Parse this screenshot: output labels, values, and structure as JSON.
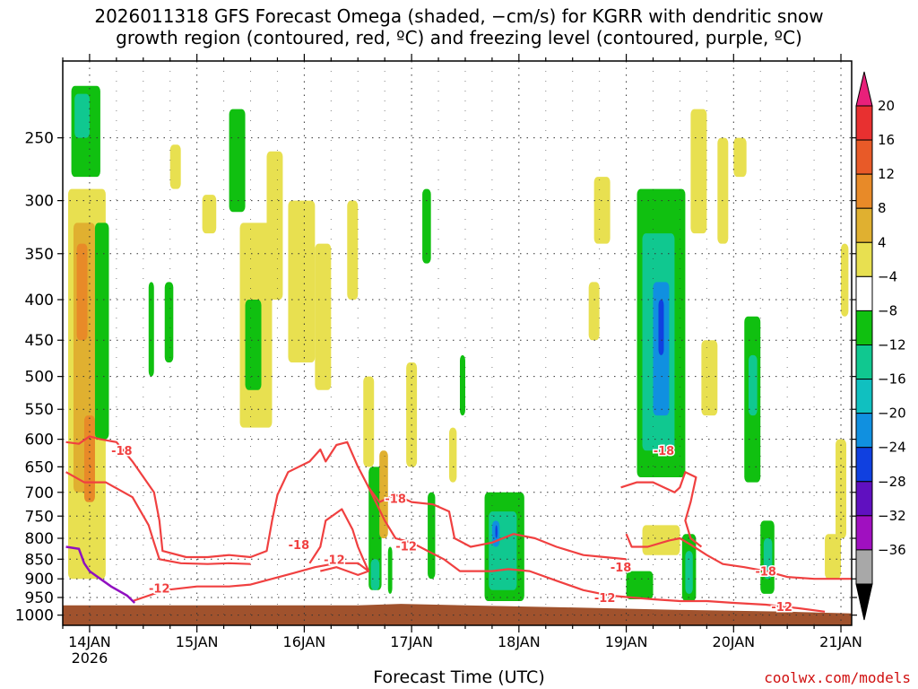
{
  "title_line1": "2026011318 GFS Forecast Omega (shaded, −cm/s) for KGRR with dendritic snow",
  "title_line2": "growth region (contoured, red, ºC) and freezing level (contoured, purple, ºC)",
  "xlabel": "Forecast Time (UTC)",
  "credit": "coolwx.com/models",
  "chart_data": {
    "type": "heatmap",
    "ylabel_ticks": [
      250,
      300,
      350,
      400,
      450,
      500,
      550,
      600,
      650,
      700,
      750,
      800,
      850,
      900,
      950,
      1000
    ],
    "y_units": "hPa",
    "y_scale": "log",
    "yrange": [
      200,
      1030
    ],
    "x_ticks": [
      {
        "day": 14,
        "label": "14JAN",
        "sub": "2026"
      },
      {
        "day": 15,
        "label": "15JAN",
        "sub": ""
      },
      {
        "day": 16,
        "label": "16JAN",
        "sub": ""
      },
      {
        "day": 17,
        "label": "17JAN",
        "sub": ""
      },
      {
        "day": 18,
        "label": "18JAN",
        "sub": ""
      },
      {
        "day": 19,
        "label": "19JAN",
        "sub": ""
      },
      {
        "day": 20,
        "label": "20JAN",
        "sub": ""
      },
      {
        "day": 21,
        "label": "21JAN",
        "sub": ""
      }
    ],
    "xrange_days": [
      13.75,
      21.1
    ],
    "grid": true,
    "colorbar": {
      "labels": [
        "20",
        "16",
        "12",
        "8",
        "4",
        "−4",
        "−8",
        "−12",
        "−16",
        "−20",
        "−24",
        "−28",
        "−32",
        "−36"
      ],
      "bins": [
        {
          "color": "#e8207a"
        },
        {
          "color": "#e83030"
        },
        {
          "color": "#e85a28"
        },
        {
          "color": "#e88a28"
        },
        {
          "color": "#e0b030"
        },
        {
          "color": "#e8e050"
        },
        {
          "color": "#ffffff"
        },
        {
          "color": "#10c010"
        },
        {
          "color": "#10c890"
        },
        {
          "color": "#10c0c0"
        },
        {
          "color": "#1090e0"
        },
        {
          "color": "#1040e0"
        },
        {
          "color": "#6010c0"
        },
        {
          "color": "#a010c0"
        },
        {
          "color": "#a8a8a8"
        },
        {
          "color": "#000000"
        }
      ]
    },
    "shaded_regions": [
      {
        "t0": 13.83,
        "t1": 14.1,
        "p0": 215,
        "p1": 280,
        "color": "#10c010"
      },
      {
        "t0": 13.86,
        "t1": 14.0,
        "p0": 220,
        "p1": 250,
        "color": "#10c890"
      },
      {
        "t0": 13.8,
        "t1": 14.15,
        "p0": 290,
        "p1": 900,
        "color": "#e8e050"
      },
      {
        "t0": 13.85,
        "t1": 14.05,
        "p0": 320,
        "p1": 700,
        "color": "#e0b030"
      },
      {
        "t0": 13.88,
        "t1": 13.98,
        "p0": 340,
        "p1": 450,
        "color": "#e88a28"
      },
      {
        "t0": 13.95,
        "t1": 14.05,
        "p0": 560,
        "p1": 720,
        "color": "#e88a28"
      },
      {
        "t0": 14.05,
        "t1": 14.18,
        "p0": 320,
        "p1": 600,
        "color": "#10c010"
      },
      {
        "t0": 14.55,
        "t1": 14.6,
        "p0": 380,
        "p1": 500,
        "color": "#10c010"
      },
      {
        "t0": 14.7,
        "t1": 14.78,
        "p0": 380,
        "p1": 480,
        "color": "#10c010"
      },
      {
        "t0": 14.75,
        "t1": 14.85,
        "p0": 255,
        "p1": 290,
        "color": "#e8e050"
      },
      {
        "t0": 15.05,
        "t1": 15.18,
        "p0": 295,
        "p1": 330,
        "color": "#e8e050"
      },
      {
        "t0": 15.3,
        "t1": 15.45,
        "p0": 230,
        "p1": 310,
        "color": "#10c010"
      },
      {
        "t0": 15.4,
        "t1": 15.7,
        "p0": 320,
        "p1": 580,
        "color": "#e8e050"
      },
      {
        "t0": 15.45,
        "t1": 15.6,
        "p0": 400,
        "p1": 520,
        "color": "#10c010"
      },
      {
        "t0": 15.65,
        "t1": 15.8,
        "p0": 260,
        "p1": 400,
        "color": "#e8e050"
      },
      {
        "t0": 15.85,
        "t1": 16.1,
        "p0": 300,
        "p1": 480,
        "color": "#e8e050"
      },
      {
        "t0": 16.1,
        "t1": 16.25,
        "p0": 340,
        "p1": 520,
        "color": "#e8e050"
      },
      {
        "t0": 16.4,
        "t1": 16.5,
        "p0": 300,
        "p1": 400,
        "color": "#e8e050"
      },
      {
        "t0": 16.55,
        "t1": 16.65,
        "p0": 500,
        "p1": 650,
        "color": "#e8e050"
      },
      {
        "t0": 16.6,
        "t1": 16.72,
        "p0": 650,
        "p1": 930,
        "color": "#10c010"
      },
      {
        "t0": 16.62,
        "t1": 16.7,
        "p0": 850,
        "p1": 930,
        "color": "#10c890"
      },
      {
        "t0": 16.7,
        "t1": 16.78,
        "p0": 620,
        "p1": 800,
        "color": "#e0b030"
      },
      {
        "t0": 16.78,
        "t1": 16.82,
        "p0": 820,
        "p1": 940,
        "color": "#10c010"
      },
      {
        "t0": 16.95,
        "t1": 17.05,
        "p0": 480,
        "p1": 650,
        "color": "#e8e050"
      },
      {
        "t0": 17.1,
        "t1": 17.18,
        "p0": 290,
        "p1": 360,
        "color": "#10c010"
      },
      {
        "t0": 17.15,
        "t1": 17.22,
        "p0": 700,
        "p1": 900,
        "color": "#10c010"
      },
      {
        "t0": 17.35,
        "t1": 17.42,
        "p0": 580,
        "p1": 680,
        "color": "#e8e050"
      },
      {
        "t0": 17.45,
        "t1": 17.5,
        "p0": 470,
        "p1": 560,
        "color": "#10c010"
      },
      {
        "t0": 17.68,
        "t1": 18.05,
        "p0": 700,
        "p1": 960,
        "color": "#10c010"
      },
      {
        "t0": 17.72,
        "t1": 17.98,
        "p0": 740,
        "p1": 930,
        "color": "#10c890"
      },
      {
        "t0": 17.75,
        "t1": 17.82,
        "p0": 760,
        "p1": 820,
        "color": "#1090e0"
      },
      {
        "t0": 17.78,
        "t1": 17.8,
        "p0": 770,
        "p1": 800,
        "color": "#1040e0"
      },
      {
        "t0": 18.7,
        "t1": 18.85,
        "p0": 280,
        "p1": 340,
        "color": "#e8e050"
      },
      {
        "t0": 18.65,
        "t1": 18.75,
        "p0": 380,
        "p1": 450,
        "color": "#e8e050"
      },
      {
        "t0": 19.1,
        "t1": 19.55,
        "p0": 290,
        "p1": 670,
        "color": "#10c010"
      },
      {
        "t0": 19.15,
        "t1": 19.45,
        "p0": 330,
        "p1": 620,
        "color": "#10c890"
      },
      {
        "t0": 19.25,
        "t1": 19.4,
        "p0": 380,
        "p1": 560,
        "color": "#1090e0"
      },
      {
        "t0": 19.3,
        "t1": 19.35,
        "p0": 400,
        "p1": 470,
        "color": "#1040e0"
      },
      {
        "t0": 19.6,
        "t1": 19.75,
        "p0": 230,
        "p1": 330,
        "color": "#e8e050"
      },
      {
        "t0": 19.0,
        "t1": 19.25,
        "p0": 880,
        "p1": 955,
        "color": "#10c010"
      },
      {
        "t0": 19.15,
        "t1": 19.5,
        "p0": 770,
        "p1": 840,
        "color": "#e8e050"
      },
      {
        "t0": 19.52,
        "t1": 19.65,
        "p0": 790,
        "p1": 960,
        "color": "#10c010"
      },
      {
        "t0": 19.55,
        "t1": 19.62,
        "p0": 830,
        "p1": 940,
        "color": "#10c890"
      },
      {
        "t0": 19.7,
        "t1": 19.85,
        "p0": 450,
        "p1": 560,
        "color": "#e8e050"
      },
      {
        "t0": 19.85,
        "t1": 19.95,
        "p0": 250,
        "p1": 340,
        "color": "#e8e050"
      },
      {
        "t0": 20.1,
        "t1": 20.25,
        "p0": 420,
        "p1": 680,
        "color": "#10c010"
      },
      {
        "t0": 20.14,
        "t1": 20.22,
        "p0": 470,
        "p1": 560,
        "color": "#10c890"
      },
      {
        "t0": 20.25,
        "t1": 20.38,
        "p0": 760,
        "p1": 940,
        "color": "#10c010"
      },
      {
        "t0": 20.28,
        "t1": 20.36,
        "p0": 800,
        "p1": 900,
        "color": "#10c890"
      },
      {
        "t0": 20.0,
        "t1": 20.12,
        "p0": 250,
        "p1": 280,
        "color": "#e8e050"
      },
      {
        "t0": 20.85,
        "t1": 21.0,
        "p0": 790,
        "p1": 900,
        "color": "#e8e050"
      },
      {
        "t0": 20.95,
        "t1": 21.05,
        "p0": 600,
        "p1": 800,
        "color": "#e8e050"
      },
      {
        "t0": 21.0,
        "t1": 21.07,
        "p0": 340,
        "p1": 420,
        "color": "#e8e050"
      }
    ],
    "red_contours": [
      {
        "level": -18,
        "points": [
          [
            13.78,
            605
          ],
          [
            13.9,
            608
          ],
          [
            14.0,
            595
          ],
          [
            14.1,
            600
          ],
          [
            14.25,
            605
          ],
          [
            14.4,
            640
          ],
          [
            14.6,
            700
          ],
          [
            14.65,
            760
          ],
          [
            14.68,
            830
          ],
          [
            14.9,
            845
          ],
          [
            15.1,
            845
          ],
          [
            15.3,
            840
          ],
          [
            15.5,
            845
          ],
          [
            15.65,
            830
          ],
          [
            15.7,
            760
          ],
          [
            15.75,
            705
          ],
          [
            15.85,
            660
          ],
          [
            16.05,
            640
          ],
          [
            16.15,
            618
          ],
          [
            16.2,
            640
          ],
          [
            16.3,
            610
          ],
          [
            16.4,
            605
          ],
          [
            16.5,
            650
          ],
          [
            16.6,
            690
          ],
          [
            16.7,
            720
          ],
          [
            16.85,
            705
          ],
          [
            17.0,
            720
          ],
          [
            17.2,
            725
          ],
          [
            17.35,
            740
          ],
          [
            17.4,
            800
          ],
          [
            17.55,
            820
          ],
          [
            17.75,
            810
          ],
          [
            17.95,
            790
          ],
          [
            18.15,
            800
          ],
          [
            18.35,
            820
          ],
          [
            18.6,
            840
          ],
          [
            18.8,
            845
          ],
          [
            19.0,
            850
          ]
        ]
      },
      {
        "level": -18,
        "points": [
          [
            13.78,
            660
          ],
          [
            13.95,
            680
          ],
          [
            14.15,
            680
          ],
          [
            14.4,
            710
          ],
          [
            14.55,
            770
          ],
          [
            14.6,
            810
          ],
          [
            14.65,
            850
          ],
          [
            14.85,
            860
          ],
          [
            15.1,
            862
          ],
          [
            15.3,
            860
          ],
          [
            15.5,
            862
          ]
        ]
      },
      {
        "level": -18,
        "points": [
          [
            16.05,
            860
          ],
          [
            16.15,
            820
          ],
          [
            16.2,
            760
          ],
          [
            16.35,
            735
          ],
          [
            16.45,
            780
          ],
          [
            16.5,
            820
          ],
          [
            16.55,
            850
          ],
          [
            16.6,
            880
          ],
          [
            16.5,
            890
          ],
          [
            16.3,
            870
          ],
          [
            16.15,
            880
          ]
        ]
      },
      {
        "level": -18,
        "points": [
          [
            19.0,
            790
          ],
          [
            19.05,
            820
          ],
          [
            19.2,
            820
          ],
          [
            19.4,
            805
          ],
          [
            19.5,
            800
          ],
          [
            19.6,
            815
          ],
          [
            19.75,
            840
          ],
          [
            19.9,
            862
          ],
          [
            20.1,
            870
          ],
          [
            20.3,
            880
          ],
          [
            20.5,
            895
          ],
          [
            20.75,
            900
          ],
          [
            21.1,
            900
          ]
        ]
      },
      {
        "level": -12,
        "points": [
          [
            14.4,
            960
          ],
          [
            14.7,
            930
          ],
          [
            15.0,
            920
          ],
          [
            15.3,
            920
          ],
          [
            15.5,
            915
          ],
          [
            15.7,
            900
          ],
          [
            15.9,
            885
          ],
          [
            16.1,
            870
          ],
          [
            16.3,
            860
          ],
          [
            16.5,
            860
          ],
          [
            16.6,
            880
          ]
        ]
      },
      {
        "level": -12,
        "points": [
          [
            16.6,
            690
          ],
          [
            16.75,
            760
          ],
          [
            16.85,
            800
          ],
          [
            17.0,
            810
          ],
          [
            17.15,
            830
          ],
          [
            17.3,
            850
          ],
          [
            17.45,
            880
          ],
          [
            17.6,
            880
          ],
          [
            17.75,
            880
          ],
          [
            17.9,
            875
          ],
          [
            18.1,
            880
          ],
          [
            18.35,
            905
          ],
          [
            18.6,
            930
          ],
          [
            18.85,
            945
          ],
          [
            19.05,
            950
          ],
          [
            19.25,
            955
          ],
          [
            19.5,
            960
          ],
          [
            19.75,
            960
          ],
          [
            20.0,
            965
          ],
          [
            20.3,
            970
          ],
          [
            20.6,
            980
          ],
          [
            20.85,
            990
          ]
        ]
      },
      {
        "level": -18,
        "points": [
          [
            18.95,
            690
          ],
          [
            19.1,
            680
          ],
          [
            19.25,
            680
          ],
          [
            19.35,
            690
          ],
          [
            19.45,
            700
          ],
          [
            19.5,
            690
          ],
          [
            19.55,
            660
          ],
          [
            19.65,
            670
          ],
          [
            19.6,
            720
          ],
          [
            19.55,
            760
          ],
          [
            19.6,
            800
          ],
          [
            19.7,
            820
          ]
        ]
      }
    ],
    "red_labels": [
      {
        "text": "-18",
        "t": 14.3,
        "p": 620
      },
      {
        "text": "-18",
        "t": 15.95,
        "p": 815
      },
      {
        "text": "-12",
        "t": 16.28,
        "p": 850
      },
      {
        "text": "-18",
        "t": 16.85,
        "p": 712
      },
      {
        "text": "-12",
        "t": 16.95,
        "p": 818
      },
      {
        "text": "-12",
        "t": 14.65,
        "p": 925
      },
      {
        "text": "-18",
        "t": 18.95,
        "p": 870
      },
      {
        "text": "-12",
        "t": 18.8,
        "p": 950
      },
      {
        "text": "-18",
        "t": 19.35,
        "p": 620
      },
      {
        "text": "-18",
        "t": 20.3,
        "p": 880
      },
      {
        "text": "-12",
        "t": 20.45,
        "p": 975
      }
    ],
    "purple_contour": [
      [
        13.78,
        820
      ],
      [
        13.9,
        825
      ],
      [
        13.95,
        860
      ],
      [
        14.0,
        880
      ],
      [
        14.1,
        900
      ],
      [
        14.2,
        920
      ],
      [
        14.35,
        945
      ],
      [
        14.42,
        965
      ]
    ],
    "ground_top_hpa": [
      [
        13.75,
        972
      ],
      [
        15.0,
        972
      ],
      [
        16.5,
        972
      ],
      [
        16.9,
        968
      ],
      [
        17.5,
        972
      ],
      [
        18.5,
        978
      ],
      [
        19.5,
        985
      ],
      [
        20.5,
        990
      ],
      [
        21.1,
        995
      ]
    ]
  }
}
